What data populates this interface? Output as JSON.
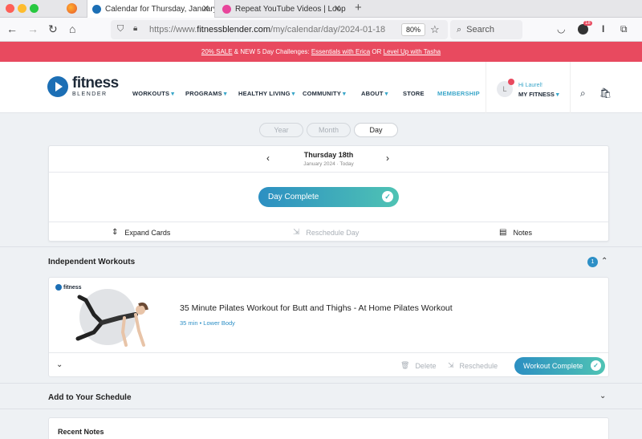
{
  "browser": {
    "tabs": [
      {
        "title": "Calendar for Thursday, January",
        "active": true
      },
      {
        "title": "Repeat YouTube Videos | LoopTu",
        "active": false
      }
    ],
    "url_prefix": "https://www.",
    "url_domain": "fitnessblender.com",
    "url_path": "/my/calendar/day/2024-01-18",
    "zoom": "80%",
    "search_placeholder": "Search",
    "notification_count": "18"
  },
  "promo": {
    "sale": "20% SALE",
    "mid": " & NEW 5 Day Challenges: ",
    "link1": "Essentials with Erica",
    "or": " OR ",
    "link2": "Level Up with Tasha"
  },
  "header": {
    "logo_big": "fitness",
    "logo_small": "BLENDER",
    "nav": [
      "WORKOUTS",
      "PROGRAMS",
      "HEALTHY LIVING",
      "COMMUNITY",
      "ABOUT",
      "STORE",
      "MEMBERSHIP"
    ],
    "greeting": "Hi Laurel!",
    "my_fitness": "MY FITNESS",
    "avatar_initial": "L"
  },
  "view_toggle": {
    "year": "Year",
    "month": "Month",
    "day": "Day",
    "selected": "Day"
  },
  "day": {
    "title": "Thursday 18th",
    "subtitle": "January 2024 · Today",
    "complete_label": "Day Complete",
    "expand_cards": "Expand Cards",
    "reschedule_day": "Reschedule Day",
    "notes": "Notes"
  },
  "independent": {
    "heading": "Independent Workouts",
    "count": "1",
    "workout": {
      "thumb_logo": "fitness",
      "title": "35 Minute Pilates Workout for Butt and Thighs - At Home Pilates Workout",
      "meta": "35 min • Lower Body",
      "delete": "Delete",
      "reschedule": "Reschedule",
      "complete": "Workout Complete"
    }
  },
  "add_schedule": {
    "heading": "Add to Your Schedule"
  },
  "recent_notes": {
    "heading": "Recent Notes"
  },
  "colors": {
    "accent": "#2d8fc6",
    "promo": "#e84a5f",
    "gradient_end": "#4fc3b4"
  }
}
